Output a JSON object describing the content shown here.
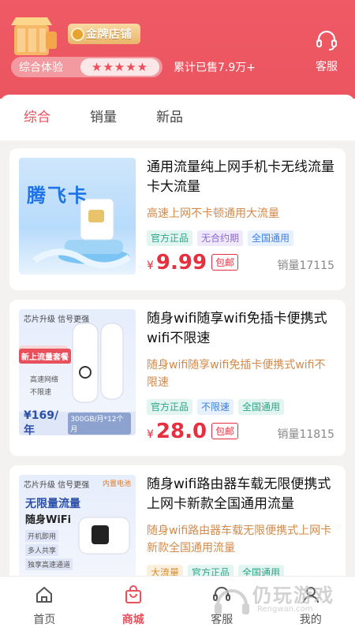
{
  "header": {
    "gold_badge": "金牌店铺",
    "rating_label": "综合体验",
    "stars": "★★★★★",
    "sold_text": "累计已售7.9万+",
    "service_label": "客服"
  },
  "tabs": [
    {
      "label": "综合"
    },
    {
      "label": "销量"
    },
    {
      "label": "新品"
    }
  ],
  "products": [
    {
      "image_text": "腾飞卡",
      "title": "通用流量纯上网手机卡无线流量卡大流量",
      "subtitle": "高速上网不卡顿通用大流量",
      "tags": [
        "官方正品",
        "无合约期",
        "全国通用"
      ],
      "currency": "¥",
      "price": "9.99",
      "shipping": "包邮",
      "sales": "销量17115"
    },
    {
      "image_text": "芯片升级 信号更强",
      "image_price": "¥169/年",
      "image_badge": "新上流量套餐",
      "image_data": "300GB/月*12个月",
      "image_features": [
        "高速网络",
        "不限速"
      ],
      "title": "随身wifi随享wifi免插卡便携式wifi不限速",
      "subtitle": "随身wifi随享wifi免插卡便携式wifi不限速",
      "tags": [
        "官方正品",
        "不限速",
        "全国通用"
      ],
      "currency": "¥",
      "price": "28.0",
      "shipping": "包邮",
      "sales": "销量11815"
    },
    {
      "image_text": "芯片升级 信号更强",
      "image_title": "无限量流量",
      "image_subtitle": "随身WiFi",
      "image_features": [
        "开机即用",
        "多人共享",
        "独享高速通道"
      ],
      "image_brand": "内置电池",
      "title": "随身wifi路由器车载无限便携式上网卡新款全国通用流量",
      "subtitle": "随身wifi路由器车载无限便携式上网卡新款全国通用流量",
      "tags": [
        "大流量",
        "官方正品",
        "全国通用"
      ]
    }
  ],
  "bottom_nav": [
    {
      "label": "首页",
      "icon": "home-icon"
    },
    {
      "label": "商城",
      "icon": "bag-icon"
    },
    {
      "label": "客服",
      "icon": "headset-icon"
    },
    {
      "label": "我的",
      "icon": "user-icon"
    }
  ],
  "watermark": {
    "text": "仍玩游戏",
    "sub": "Rengwan.com"
  },
  "colors": {
    "brand": "#eb5560",
    "price": "#e62f3f",
    "accent_text": "#d18a4a"
  }
}
